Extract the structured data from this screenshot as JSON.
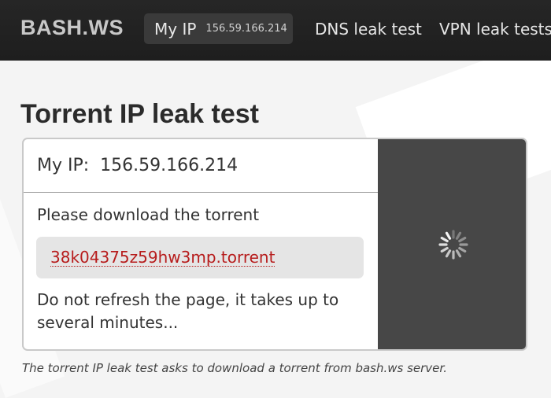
{
  "header": {
    "logo": "BASH.WS",
    "my_ip_label": "My IP",
    "my_ip_value": "156.59.166.214",
    "nav": {
      "dns": "DNS leak test",
      "vpn": "VPN leak tests"
    }
  },
  "main": {
    "title": "Torrent IP leak test",
    "panel": {
      "my_ip_label": "My IP:",
      "my_ip_value": "156.59.166.214",
      "instruction": "Please download the torrent",
      "torrent_file": "38k04375z59hw3mp.torrent",
      "notice": "Do not refresh the page, it takes up to several minutes...",
      "status_icon": "loading-spinner-icon"
    },
    "footnote": "The torrent IP leak test asks to download a torrent from bash.ws server."
  },
  "colors": {
    "topbar": "#222222",
    "link": "#b71c1c",
    "spinner_panel": "#474747"
  }
}
